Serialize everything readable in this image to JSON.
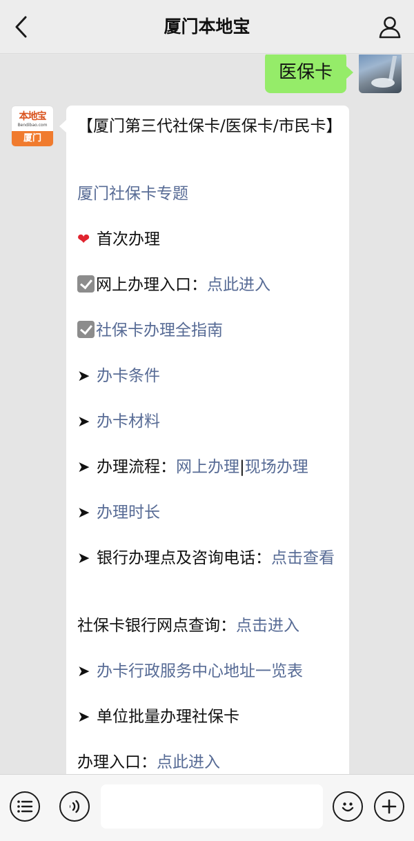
{
  "header": {
    "title": "厦门本地宝"
  },
  "outgoing": {
    "text": "医保卡"
  },
  "account": {
    "logo_name": "本地宝",
    "logo_domain": "Bendibao.com",
    "logo_city": "厦门"
  },
  "message": {
    "title": "【厦门第三代社保卡/医保卡/市民卡】",
    "topic_link": "厦门社保卡专题",
    "first_time": "首次办理",
    "online_entry_label": "网上办理入口：",
    "online_entry_link": "点此进入",
    "guide_link": "社保卡办理全指南",
    "conditions_link": "办卡条件",
    "materials_link": "办卡材料",
    "process_label": "办理流程：",
    "process_online_link": "网上办理",
    "process_sep": "|",
    "process_onsite_link": "现场办理",
    "duration_link": "办理时长",
    "bank_label": "银行办理点及咨询电话：",
    "bank_link": "点击查看",
    "bank_query_label": "社保卡银行网点查询：",
    "bank_query_link": "点击进入",
    "service_center_link": "办卡行政服务中心地址一览表",
    "batch_label": "单位批量办理社保卡",
    "batch_entry_label": "办理入口：",
    "batch_entry_link": "点此进入"
  },
  "icons": {
    "back": "chevron-left-icon",
    "user": "user-icon",
    "menu": "list-icon",
    "voice": "voice-icon",
    "emoji": "emoji-icon",
    "add": "plus-icon"
  },
  "colors": {
    "link": "#576b95",
    "outgoing_bubble": "#95ec69"
  }
}
